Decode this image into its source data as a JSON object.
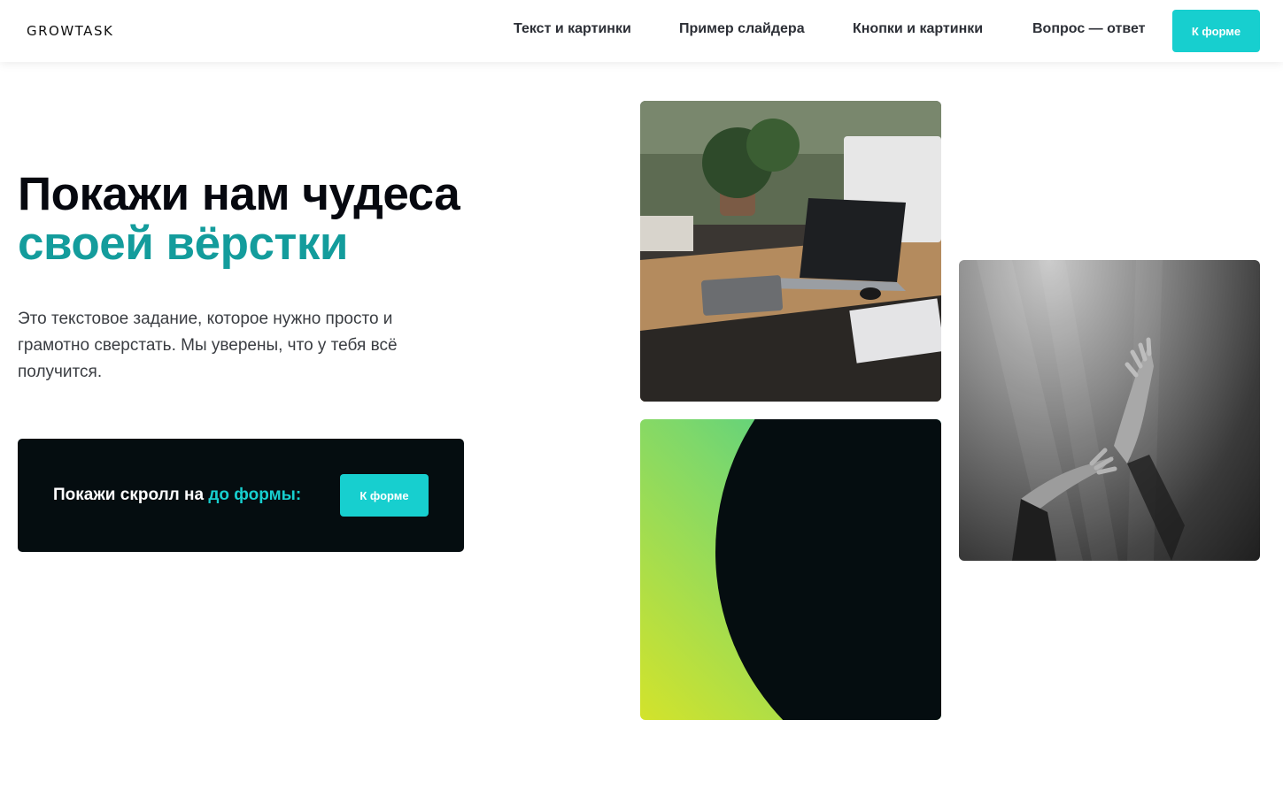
{
  "header": {
    "logo": "GROWTASK",
    "nav": [
      {
        "label": "Текст и картинки"
      },
      {
        "label": "Пример слайдера"
      },
      {
        "label": "Кнопки и картинки"
      },
      {
        "label": "Вопрос — ответ"
      }
    ],
    "cta_label": "К форме",
    "cta_color": "#17cfcf"
  },
  "hero": {
    "title_line1": "Покажи нам чудеса",
    "title_line2": "своей вёрстки",
    "accent_color": "#139c9c",
    "description": "Это текстовое задание, которое нужно просто и грамотно сверстать. Мы уверены, что у тебя всё получится."
  },
  "scroll_card": {
    "text_prefix": "Покажи скролл на ",
    "text_highlight": "до формы:",
    "button_label": "К форме",
    "background": "#050d10"
  },
  "images": [
    {
      "name": "desk-workspace-photo"
    },
    {
      "name": "abstract-gradient-circle"
    },
    {
      "name": "underwater-hands-photo"
    }
  ]
}
